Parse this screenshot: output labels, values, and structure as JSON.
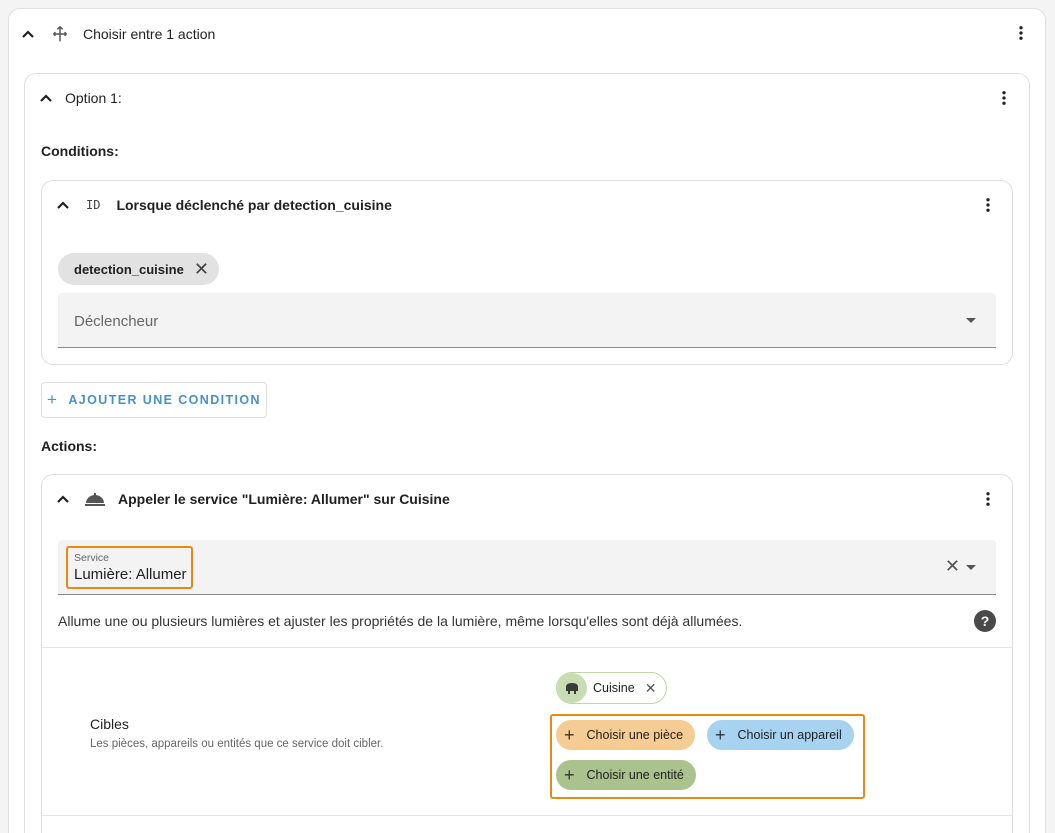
{
  "top": {
    "title": "Choisir entre 1 action",
    "icons": {
      "collapse": "chevron-up-icon",
      "type": "arrows-split-icon",
      "menu": "more-vertical-icon"
    }
  },
  "option": {
    "title": "Option 1:",
    "conditions_label": "Conditions:",
    "condition": {
      "id_badge": "ID",
      "title": "Lorsque déclenché par detection_cuisine",
      "chip": "detection_cuisine",
      "trigger_placeholder": "Déclencheur"
    },
    "add_condition": "AJOUTER UNE CONDITION",
    "actions_label": "Actions:",
    "action": {
      "title": "Appeler le service \"Lumière: Allumer\" sur Cuisine",
      "service_label": "Service",
      "service_value": "Lumière: Allumer",
      "description": "Allume une ou plusieurs lumières et ajuster les propriétés de la lumière, même lorsqu'elles sont déjà allumées.",
      "help": "?",
      "targets_title": "Cibles",
      "targets_sub": "Les pièces, appareils ou entités que ce service doit cibler.",
      "target_chip": "Cuisine",
      "pick_area": "Choisir une pièce",
      "pick_device": "Choisir un appareil",
      "pick_entity": "Choisir une entité"
    }
  },
  "colors": {
    "highlight": "#e38b14",
    "area_chip": "#f5cc94",
    "device_chip": "#a7d3f0",
    "entity_chip": "#a9c28e",
    "link": "#4a90c2"
  }
}
